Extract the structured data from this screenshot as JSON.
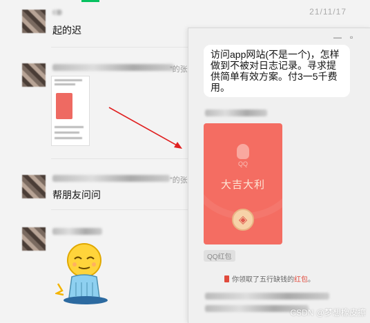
{
  "chat_list": {
    "date": "21/11/17",
    "msg1_text": "起的迟",
    "quote_marker_1": "”的张",
    "quote_marker_2": "”的张",
    "msg3_text": "帮朋友问问"
  },
  "popup": {
    "minimize_icon": "minimize-icon",
    "maximize_icon": "maximize-icon",
    "message_text": "访问app网站(不是一个)，怎样做到不被对日志记录。寻求提供简单有效方案。付3一5千费用。",
    "red_packet": {
      "brand": "QQ",
      "greeting": "大吉大利",
      "label": "QQ红包"
    },
    "notice_prefix": "你领取了五行缺钱的",
    "notice_link": "红包",
    "notice_suffix": "。"
  },
  "watermark": "CSDN @梦想橡皮擦",
  "colors": {
    "accent": "#07c160",
    "red_packet": "#f46d62",
    "arrow": "#e02020"
  }
}
